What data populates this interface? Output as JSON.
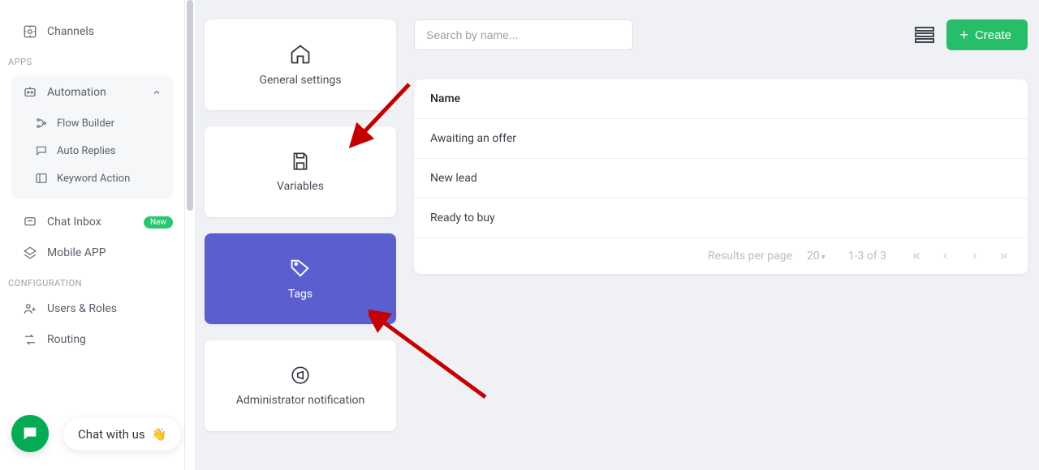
{
  "sidebar": {
    "channels": "Channels",
    "section_apps": "APPS",
    "automation": "Automation",
    "flow_builder": "Flow Builder",
    "auto_replies": "Auto Replies",
    "keyword_action": "Keyword Action",
    "chat_inbox": "Chat Inbox",
    "new_badge": "New",
    "mobile_app": "Mobile APP",
    "section_config": "CONFIGURATION",
    "users_roles": "Users & Roles",
    "routing": "Routing"
  },
  "cards": {
    "general": "General settings",
    "variables": "Variables",
    "tags": "Tags",
    "admin_notif": "Administrator notification"
  },
  "search": {
    "placeholder": "Search by name..."
  },
  "create_label": "Create",
  "table": {
    "header": "Name",
    "rows": [
      "Awaiting an offer",
      "New lead",
      "Ready to buy"
    ]
  },
  "pager": {
    "rpp_label": "Results per page",
    "rpp_value": "20",
    "range": "1-3 of 3"
  },
  "chat": {
    "label": "Chat with us",
    "emoji": "👋"
  }
}
